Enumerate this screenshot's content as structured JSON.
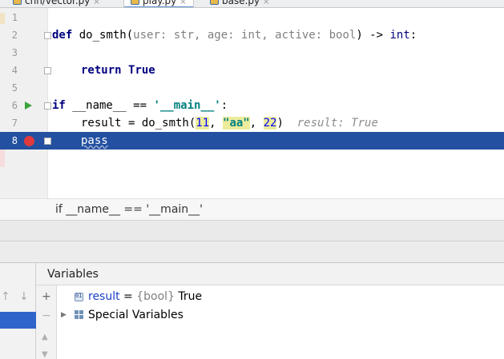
{
  "tabs": [
    {
      "label": "cnn/vector.py",
      "close": "×",
      "active": false
    },
    {
      "label": "play.py",
      "close": "×",
      "active": true
    },
    {
      "label": "base.py",
      "close": "×",
      "active": false
    }
  ],
  "editor": {
    "line_numbers": [
      "1",
      "2",
      "3",
      "4",
      "5",
      "6",
      "7",
      "8"
    ],
    "line2": {
      "kw_def": "def",
      "name": " do_smth(",
      "hint": "user: str, age: int, active: bool",
      "close": ") -> ",
      "ret_type": "int",
      "colon": ":"
    },
    "line4": {
      "kw_return": "return",
      "kw_true": "True"
    },
    "line6": {
      "kw_if": "if",
      "cond": " __name__ == ",
      "str_main": "'__main__'",
      "colon": ":"
    },
    "line7": {
      "lhs": "result = do_smth(",
      "arg1": "11",
      "sep1": ", ",
      "arg2": "\"aa\"",
      "sep2": ", ",
      "arg3": "22",
      "close": ")",
      "inlay": "result: True"
    },
    "line8": {
      "code": "pass"
    }
  },
  "breadcrumb": {
    "text": "if __name__ == '__main__'"
  },
  "debugger": {
    "frames_up_arrow": "↑",
    "frames_down_arrow": "↓",
    "variables_title": "Variables",
    "toolbar": {
      "add": "+",
      "remove": "−",
      "up": "▲",
      "down": "▼"
    },
    "variables": [
      {
        "name": "result",
        "equals": " = ",
        "type": "{bool}",
        "value": " True",
        "expanded": false
      },
      {
        "name": "Special Variables",
        "expander": "▶"
      }
    ]
  },
  "colors": {
    "selection": "#2350a0",
    "keyword": "#000080",
    "string": "#008080",
    "number": "#0000ff",
    "breakpoint": "#e0393e",
    "run": "#3aa33a",
    "var_name": "#1c41c9"
  }
}
